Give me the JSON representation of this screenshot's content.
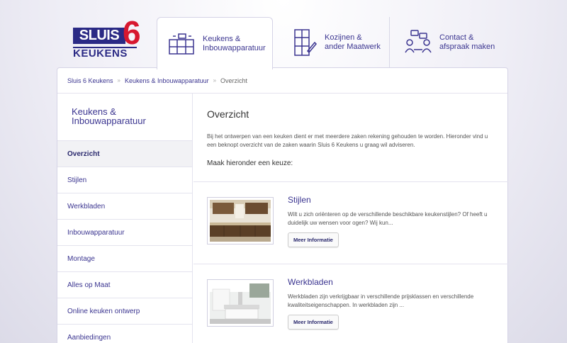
{
  "logo": {
    "line1": "SLUIS",
    "digit": "6",
    "line2": "KEUKENS"
  },
  "tabs": [
    {
      "line1": "Keukens &",
      "line2": "Inbouwapparatuur",
      "icon": "kitchen-cabinet-icon"
    },
    {
      "line1": "Kozijnen &",
      "line2": "ander Maatwerk",
      "icon": "window-frame-icon"
    },
    {
      "line1": "Contact &",
      "line2": "afspraak maken",
      "icon": "people-chat-icon"
    }
  ],
  "breadcrumb": {
    "home": "Sluis 6 Keukens",
    "section": "Keukens & Inbouwapparatuur",
    "current": "Overzicht",
    "sep": "»"
  },
  "sidebar": {
    "title1": "Keukens &",
    "title2": "Inbouwapparatuur",
    "items": [
      "Overzicht",
      "Stijlen",
      "Werkbladen",
      "Inbouwapparatuur",
      "Montage",
      "Alles op Maat",
      "Online keuken ontwerp",
      "Aanbiedingen"
    ]
  },
  "main": {
    "title": "Overzicht",
    "intro": "Bij het ontwerpen van een keuken dient er met meerdere zaken rekening gehouden te worden. Hieronder vind u een beknopt overzicht van de zaken waarin Sluis 6 Keukens u graag wil adviseren.",
    "choose": "Maak hieronder een keuze:",
    "items": [
      {
        "title": "Stijlen",
        "text": "Wilt u zich oriënteren op de verschillende beschikbare keukenstijlen? Of heeft u duidelijk uw wensen voor ogen? Wij kun...",
        "button": "Meer Informatie"
      },
      {
        "title": "Werkbladen",
        "text": "Werkbladen zijn verkrijgbaar in verschillende prijsklassen en verschillende kwaliteitseigenschappen. In werkbladen zijn ...",
        "button": "Meer Informatie"
      }
    ]
  },
  "colors": {
    "brand": "#2b2a85",
    "accent": "#d7172f"
  }
}
